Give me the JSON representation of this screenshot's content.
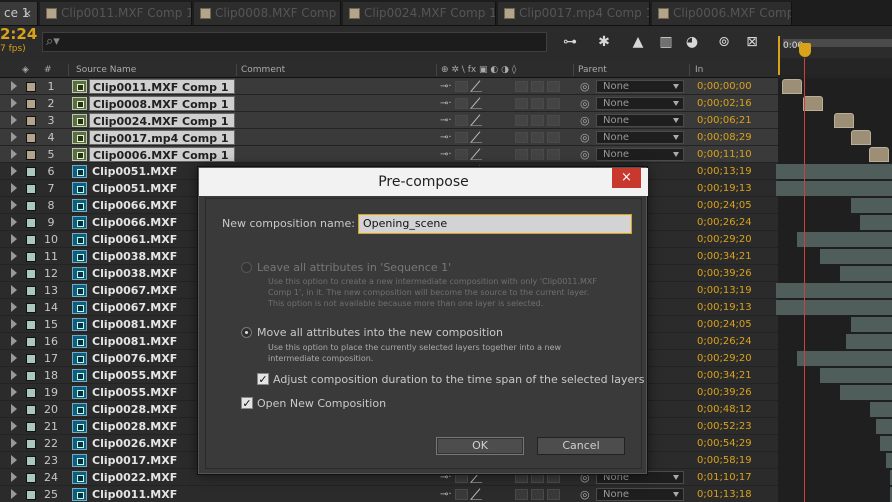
{
  "tabs": [
    {
      "label": "ce 1",
      "close": "×",
      "active": true
    },
    {
      "label": "Clip0011.MXF Comp 1"
    },
    {
      "label": "Clip0008.MXF Comp 1"
    },
    {
      "label": "Clip0024.MXF Comp 1"
    },
    {
      "label": "Clip0017.mp4 Comp 1"
    },
    {
      "label": "Clip0006.MXF Comp 1"
    }
  ],
  "header": {
    "timecode": "2:24",
    "fps": "7 fps)",
    "search_glyph": "⌕▾",
    "ruler_start": "0:00s"
  },
  "columns": {
    "number": "#",
    "source_name": "Source Name",
    "comment": "Comment",
    "switches": "⊕ ✲ \\ fx ▣ ◐ ◑ ◊",
    "parent": "Parent",
    "in": "In"
  },
  "layers": [
    {
      "num": "1",
      "name": "Clip0011.MXF Comp 1",
      "type": "comp",
      "selected": true,
      "label": "#b3a48a",
      "parent": "None",
      "in": "0;00;00;00"
    },
    {
      "num": "2",
      "name": "Clip0008.MXF Comp 1",
      "type": "comp",
      "selected": true,
      "label": "#b3a48a",
      "parent": "None",
      "in": "0;00;02;16"
    },
    {
      "num": "3",
      "name": "Clip0024.MXF Comp 1",
      "type": "comp",
      "selected": true,
      "label": "#b3a48a",
      "parent": "None",
      "in": "0;00;06;21"
    },
    {
      "num": "4",
      "name": "Clip0017.mp4 Comp 1",
      "type": "comp",
      "selected": true,
      "label": "#b3a48a",
      "parent": "None",
      "in": "0;00;08;29"
    },
    {
      "num": "5",
      "name": "Clip0006.MXF Comp 1",
      "type": "comp",
      "selected": true,
      "label": "#b3a48a",
      "parent": "None",
      "in": "0;00;11;10"
    },
    {
      "num": "6",
      "name": "Clip0051.MXF",
      "type": "footage",
      "label": "#a9c8c2",
      "in": "0;00;13;19"
    },
    {
      "num": "7",
      "name": "Clip0051.MXF",
      "type": "footage",
      "label": "#a9c8c2",
      "in": "0;00;19;13"
    },
    {
      "num": "8",
      "name": "Clip0066.MXF",
      "type": "footage",
      "label": "#a9c8c2",
      "in": "0;00;24;05"
    },
    {
      "num": "9",
      "name": "Clip0066.MXF",
      "type": "footage",
      "label": "#a9c8c2",
      "in": "0;00;26;24"
    },
    {
      "num": "10",
      "name": "Clip0061.MXF",
      "type": "footage",
      "label": "#a9c8c2",
      "in": "0;00;29;20"
    },
    {
      "num": "11",
      "name": "Clip0038.MXF",
      "type": "footage",
      "label": "#a9c8c2",
      "in": "0;00;34;21"
    },
    {
      "num": "12",
      "name": "Clip0038.MXF",
      "type": "footage",
      "label": "#a9c8c2",
      "in": "0;00;39;26"
    },
    {
      "num": "13",
      "name": "Clip0067.MXF",
      "type": "footage",
      "label": "#a9c8c2",
      "in": "0;00;13;19"
    },
    {
      "num": "14",
      "name": "Clip0067.MXF",
      "type": "footage",
      "label": "#a9c8c2",
      "in": "0;00;19;13"
    },
    {
      "num": "15",
      "name": "Clip0081.MXF",
      "type": "footage",
      "label": "#a9c8c2",
      "in": "0;00;24;05"
    },
    {
      "num": "16",
      "name": "Clip0081.MXF",
      "type": "footage",
      "label": "#a9c8c2",
      "in": "0;00;26;24"
    },
    {
      "num": "17",
      "name": "Clip0076.MXF",
      "type": "footage",
      "label": "#a9c8c2",
      "in": "0;00;29;20"
    },
    {
      "num": "18",
      "name": "Clip0055.MXF",
      "type": "footage",
      "label": "#a9c8c2",
      "in": "0;00;34;21"
    },
    {
      "num": "19",
      "name": "Clip0055.MXF",
      "type": "footage",
      "label": "#a9c8c2",
      "in": "0;00;39;26"
    },
    {
      "num": "20",
      "name": "Clip0028.MXF",
      "type": "footage",
      "label": "#a9c8c2",
      "in": "0;00;48;12"
    },
    {
      "num": "21",
      "name": "Clip0028.MXF",
      "type": "footage",
      "label": "#a9c8c2",
      "in": "0;00;52;23"
    },
    {
      "num": "22",
      "name": "Clip0026.MXF",
      "type": "footage",
      "label": "#a9c8c2",
      "in": "0;00;54;29"
    },
    {
      "num": "23",
      "name": "Clip0017.MXF",
      "type": "footage",
      "label": "#a9c8c2",
      "in": "0;00;58;19"
    },
    {
      "num": "24",
      "name": "Clip0022.MXF",
      "type": "footage",
      "label": "#a9c8c2",
      "parent": "None",
      "in": "0;01;10;17"
    },
    {
      "num": "25",
      "name": "Clip0011.MXF",
      "type": "footage",
      "label": "#a9c8c2",
      "parent": "None",
      "in": "0;01;13;18"
    }
  ],
  "dialog": {
    "title": "Pre-compose",
    "close": "×",
    "name_label": "New composition name:",
    "name_value": "Opening_scene",
    "leave_label": "Leave all attributes in 'Sequence 1'",
    "leave_help": [
      "Use this option to create a new intermediate composition with only 'Clip0011.MXF",
      "Comp 1', in it. The new composition will become the source to the current layer.",
      "This option is not available because more than one layer is selected."
    ],
    "move_label": "Move all attributes into the new composition",
    "move_help": [
      "Use this option to place the currently selected layers together into a new",
      "intermediate composition."
    ],
    "adjust_label": "Adjust composition duration to the time span of the selected layers",
    "open_label": "Open New Composition",
    "check_glyph": "✓",
    "ok": "OK",
    "cancel": "Cancel"
  },
  "colors": {
    "accent": "#d9a21b",
    "playhead": "#d23f3f",
    "close": "#c8382d"
  }
}
